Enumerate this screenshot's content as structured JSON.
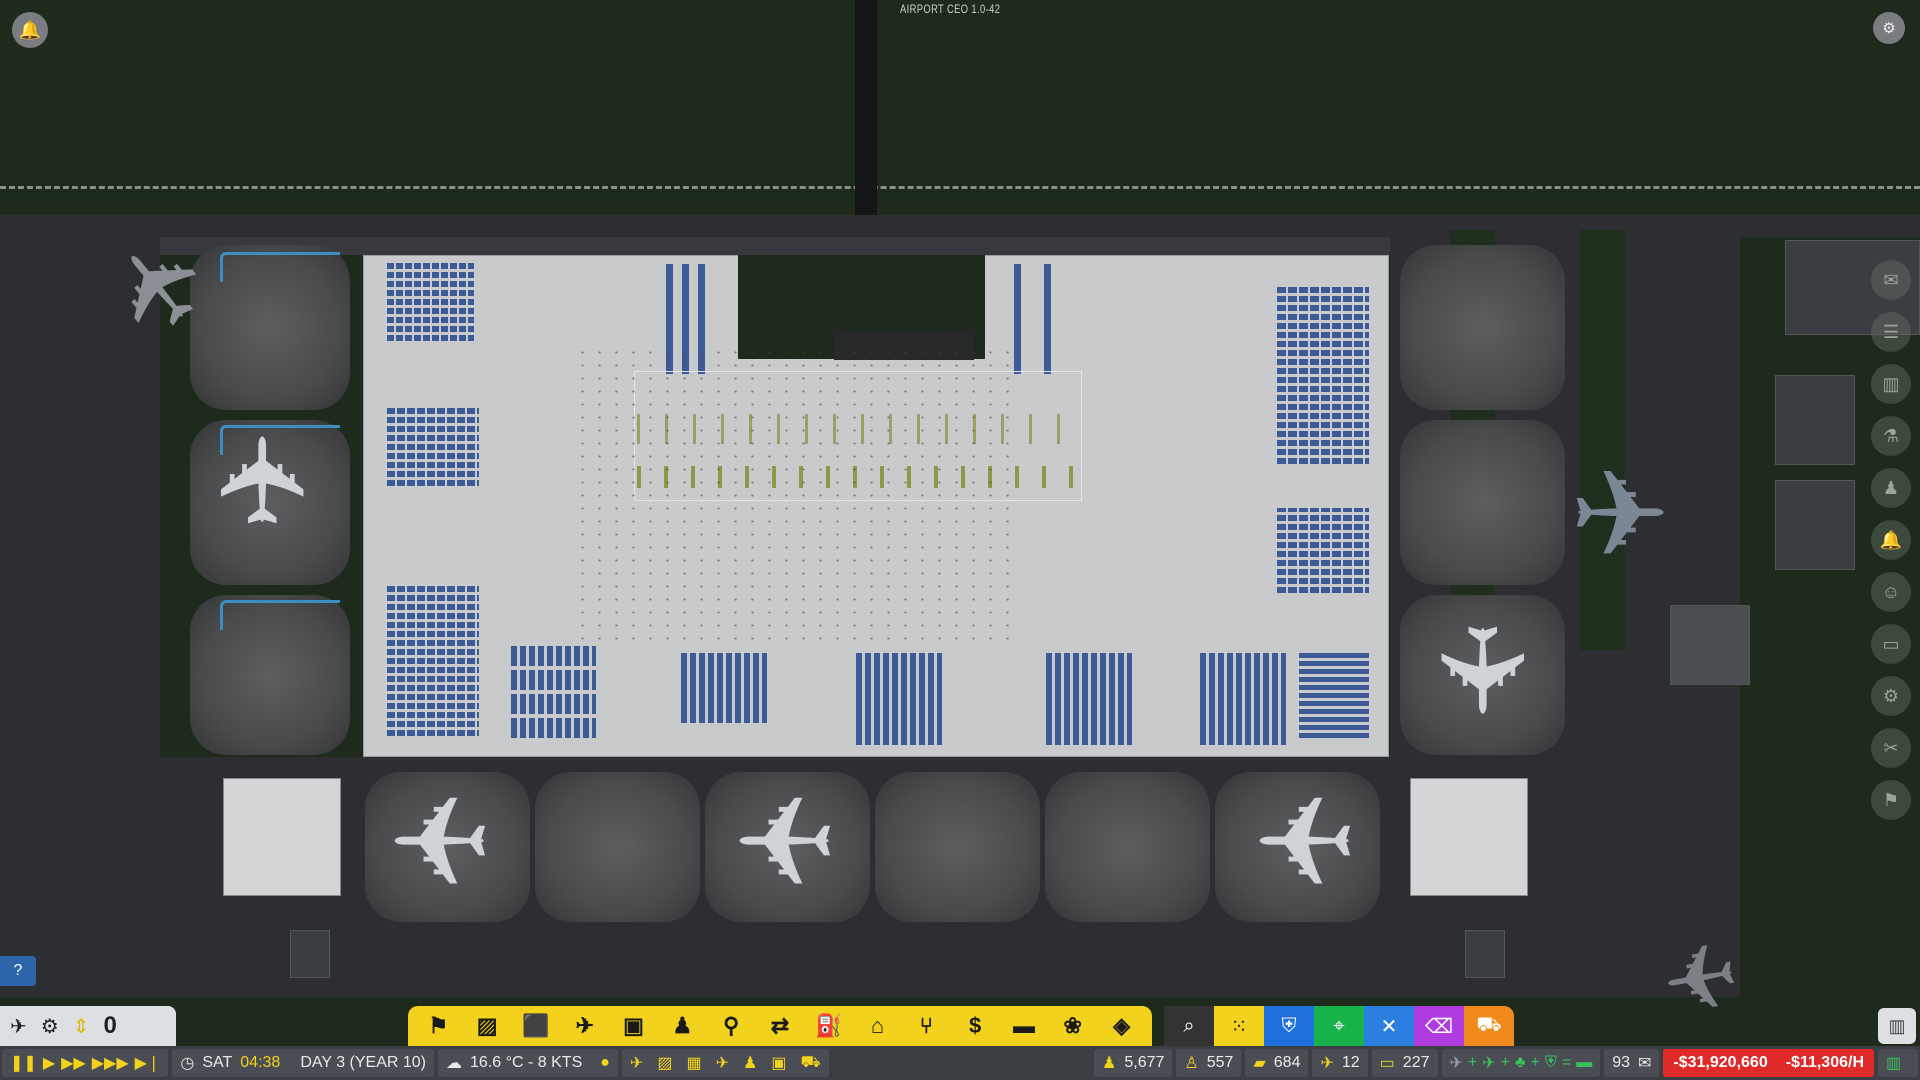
{
  "game": {
    "title": "AIRPORT CEO 1.0-42"
  },
  "left_controls": {
    "counter": "0",
    "icons": [
      "flight-schedule-icon",
      "settings-gears-icon",
      "up-down-arrows-icon"
    ]
  },
  "toolbar": {
    "build_icons": [
      "runway-icon",
      "zone-icon",
      "bus-icon",
      "plane-icon",
      "suitcase-icon",
      "staff-icon",
      "security-icon",
      "baggage-icon",
      "fuel-icon",
      "stand-icon",
      "food-icon",
      "money-icon",
      "seats-icon",
      "plants-icon",
      "layers-icon"
    ],
    "right_icons": [
      "search-icon",
      "grid-icon",
      "shield-icon",
      "satellite-icon",
      "cancel-build-icon",
      "delete-icon",
      "bulldozer-icon"
    ]
  },
  "status": {
    "day": "SAT",
    "time": "04:38",
    "date": "DAY 3 (YEAR 10)",
    "weather": "16.6 °C - 8 KTS",
    "passengers": "5,677",
    "employees": "557",
    "bags": "684",
    "flights": "12",
    "vehicles": "227",
    "messages": "93",
    "balance": "-$31,920,660",
    "rate": "-$11,306/H"
  },
  "labels": {
    "help": "?"
  }
}
